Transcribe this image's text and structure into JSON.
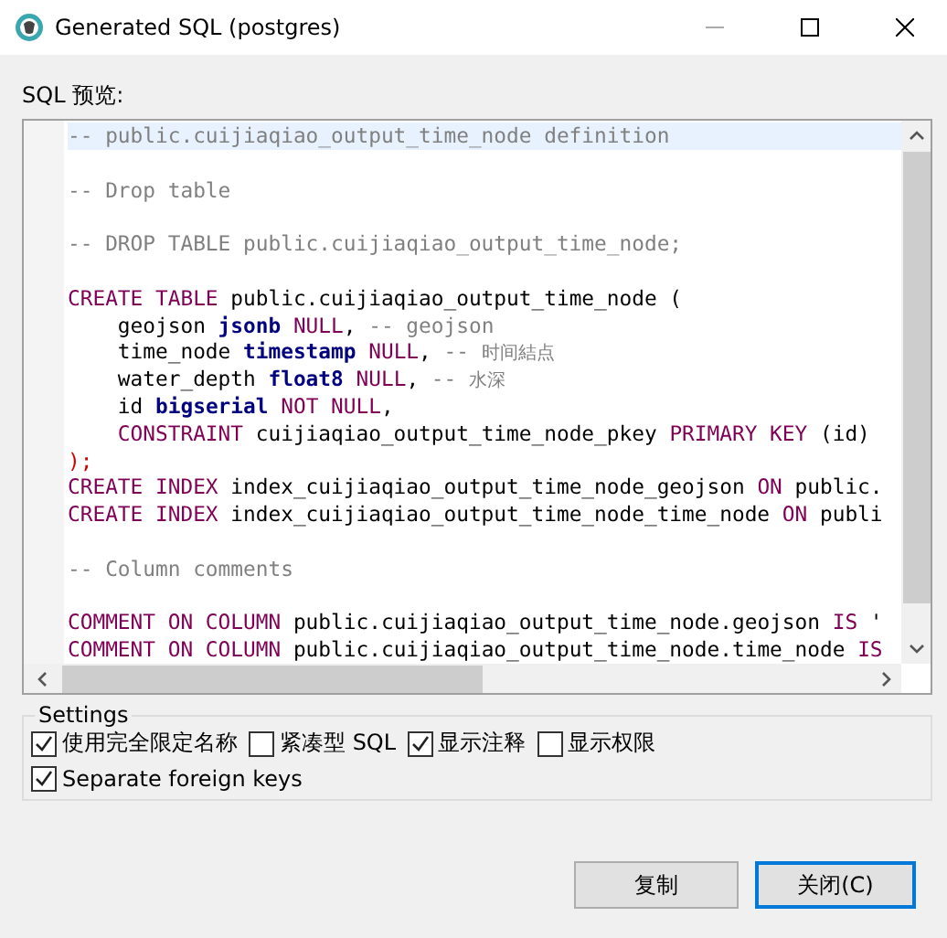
{
  "window": {
    "title": "Generated SQL (postgres)"
  },
  "preview_label": "SQL 预览:",
  "code_lines": [
    {
      "kind": "code",
      "current": true,
      "tokens": [
        {
          "kind": "comment",
          "text": "-- public.cuijiaqiao_output_time_node definition"
        }
      ]
    },
    {
      "kind": "blank",
      "current": false
    },
    {
      "kind": "code",
      "current": false,
      "tokens": [
        {
          "kind": "comment",
          "text": "-- Drop table"
        }
      ]
    },
    {
      "kind": "blank",
      "current": false
    },
    {
      "kind": "code",
      "current": false,
      "tokens": [
        {
          "kind": "comment",
          "text": "-- DROP TABLE public.cuijiaqiao_output_time_node;"
        }
      ]
    },
    {
      "kind": "blank",
      "current": false
    },
    {
      "kind": "code",
      "current": false,
      "tokens": [
        {
          "kind": "keyword",
          "text": "CREATE TABLE"
        },
        {
          "kind": "plain",
          "text": " public.cuijiaqiao_output_time_node ("
        }
      ]
    },
    {
      "kind": "code",
      "current": false,
      "tokens": [
        {
          "kind": "plain",
          "text": "    geojson "
        },
        {
          "kind": "type",
          "text": "jsonb"
        },
        {
          "kind": "keyword",
          "text": " NULL"
        },
        {
          "kind": "plain",
          "text": ", "
        },
        {
          "kind": "comment",
          "text": "-- geojson"
        }
      ]
    },
    {
      "kind": "code",
      "current": false,
      "tokens": [
        {
          "kind": "plain",
          "text": "    time_node "
        },
        {
          "kind": "type",
          "text": "timestamp"
        },
        {
          "kind": "keyword",
          "text": " NULL"
        },
        {
          "kind": "plain",
          "text": ", "
        },
        {
          "kind": "comment",
          "text": "-- "
        },
        {
          "kind": "note",
          "text": "时间結点"
        }
      ]
    },
    {
      "kind": "code",
      "current": false,
      "tokens": [
        {
          "kind": "plain",
          "text": "    water_depth "
        },
        {
          "kind": "type",
          "text": "float8"
        },
        {
          "kind": "keyword",
          "text": " NULL"
        },
        {
          "kind": "plain",
          "text": ", "
        },
        {
          "kind": "comment",
          "text": "-- "
        },
        {
          "kind": "note",
          "text": "水深"
        }
      ]
    },
    {
      "kind": "code",
      "current": false,
      "tokens": [
        {
          "kind": "plain",
          "text": "    id "
        },
        {
          "kind": "type",
          "text": "bigserial"
        },
        {
          "kind": "keyword",
          "text": " NOT NULL"
        },
        {
          "kind": "plain",
          "text": ","
        }
      ]
    },
    {
      "kind": "code",
      "current": false,
      "tokens": [
        {
          "kind": "keyword",
          "text": "    CONSTRAINT"
        },
        {
          "kind": "plain",
          "text": " cuijiaqiao_output_time_node_pkey "
        },
        {
          "kind": "keyword",
          "text": "PRIMARY KEY"
        },
        {
          "kind": "plain",
          "text": " (id)"
        }
      ]
    },
    {
      "kind": "code",
      "current": false,
      "tokens": [
        {
          "kind": "punct",
          "text": ");"
        }
      ]
    },
    {
      "kind": "code",
      "current": false,
      "tokens": [
        {
          "kind": "keyword",
          "text": "CREATE INDEX"
        },
        {
          "kind": "plain",
          "text": " index_cuijiaqiao_output_time_node_geojson "
        },
        {
          "kind": "keyword",
          "text": "ON"
        },
        {
          "kind": "plain",
          "text": " public."
        }
      ]
    },
    {
      "kind": "code",
      "current": false,
      "tokens": [
        {
          "kind": "keyword",
          "text": "CREATE INDEX"
        },
        {
          "kind": "plain",
          "text": " index_cuijiaqiao_output_time_node_time_node "
        },
        {
          "kind": "keyword",
          "text": "ON"
        },
        {
          "kind": "plain",
          "text": " publi"
        }
      ]
    },
    {
      "kind": "blank",
      "current": false
    },
    {
      "kind": "code",
      "current": false,
      "tokens": [
        {
          "kind": "comment",
          "text": "-- Column comments"
        }
      ]
    },
    {
      "kind": "blank",
      "current": false
    },
    {
      "kind": "code",
      "current": false,
      "tokens": [
        {
          "kind": "keyword",
          "text": "COMMENT ON COLUMN"
        },
        {
          "kind": "plain",
          "text": " public.cuijiaqiao_output_time_node.geojson "
        },
        {
          "kind": "keyword",
          "text": "IS"
        },
        {
          "kind": "plain",
          "text": " '"
        }
      ]
    },
    {
      "kind": "code",
      "current": false,
      "tokens": [
        {
          "kind": "keyword",
          "text": "COMMENT ON COLUMN"
        },
        {
          "kind": "plain",
          "text": " public.cuijiaqiao_output_time_node.time_node "
        },
        {
          "kind": "keyword",
          "text": "IS"
        }
      ]
    }
  ],
  "settings": {
    "title": "Settings",
    "options": [
      {
        "label": "使用完全限定名称",
        "checked": true
      },
      {
        "label": "紧凑型 SQL",
        "checked": false
      },
      {
        "label": "显示注释",
        "checked": true
      },
      {
        "label": "显示权限",
        "checked": false
      },
      {
        "label": "Separate foreign keys",
        "checked": true
      }
    ]
  },
  "buttons": [
    {
      "label": "复制",
      "default": false
    },
    {
      "label": "关闭(C)",
      "default": true
    }
  ]
}
